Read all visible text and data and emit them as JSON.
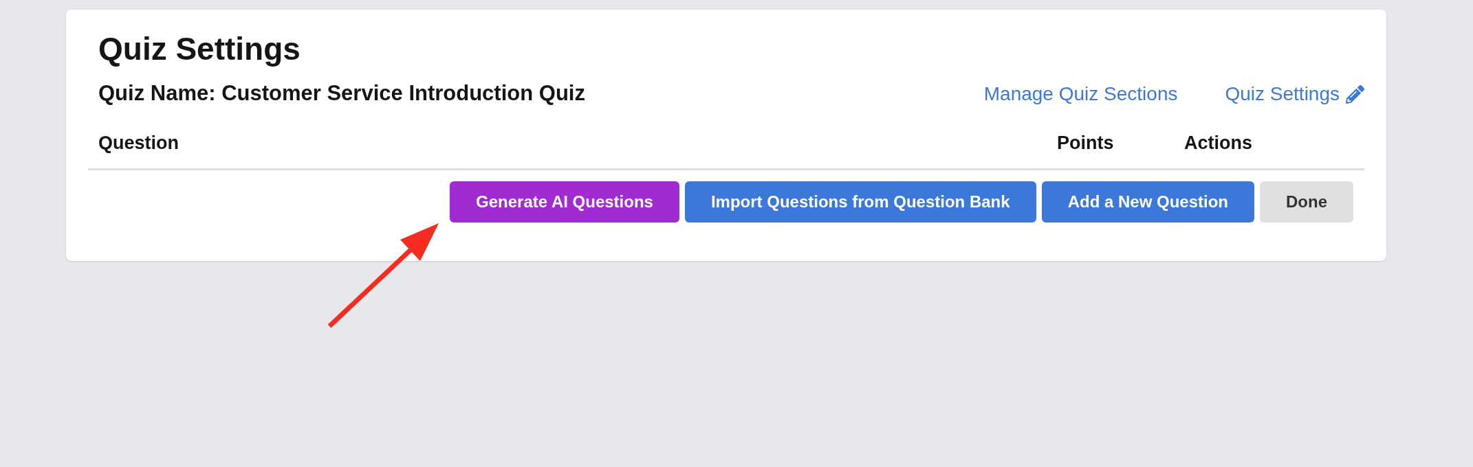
{
  "page_title": "Quiz Settings",
  "quiz_name": "Quiz Name: Customer Service Introduction Quiz",
  "links": [
    {
      "label": "Manage Quiz Sections",
      "kind": "text"
    },
    {
      "label": "Quiz Settings",
      "kind": "edit"
    }
  ],
  "table": {
    "columns": [
      "Question",
      "Points",
      "Actions"
    ]
  },
  "buttons": [
    {
      "label": "Generate AI Questions",
      "kind": "ai"
    },
    {
      "label": "Import Questions from Question Bank",
      "kind": "primary"
    },
    {
      "label": "Add a New Question",
      "kind": "primary"
    },
    {
      "label": "Done",
      "kind": "secondary"
    }
  ]
}
